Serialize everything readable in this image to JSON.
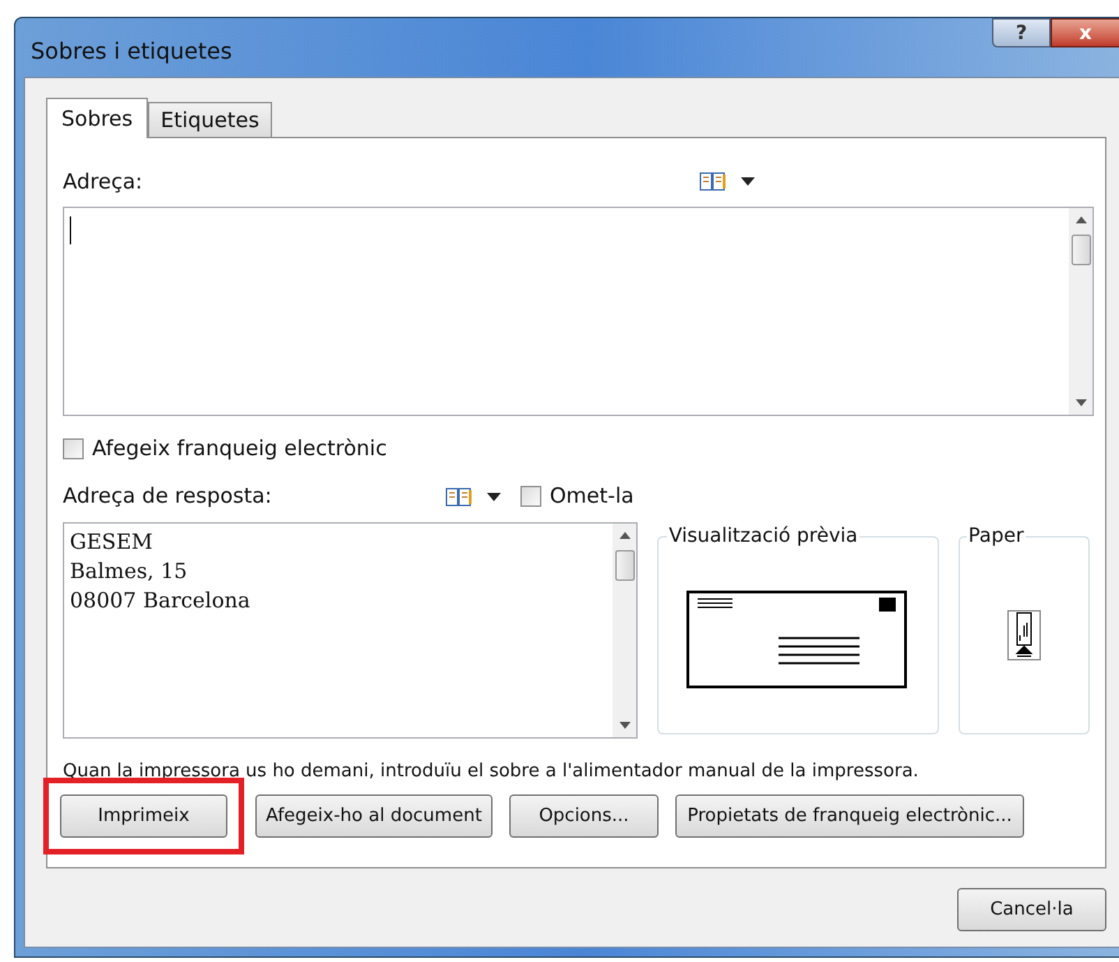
{
  "window": {
    "title": "Sobres i etiquetes",
    "help": "?",
    "close": "x"
  },
  "tabs": [
    {
      "label": "Sobres",
      "selected": true
    },
    {
      "label": "Etiquetes",
      "selected": false
    }
  ],
  "address": {
    "label": "Adreça:"
  },
  "electronic_postage": {
    "label": "Afegeix franqueig electrònic",
    "checked": false
  },
  "return_address": {
    "label": "Adreça de resposta:",
    "omit": {
      "label": "Omet-la",
      "checked": false
    },
    "lines": [
      "GESEM",
      "Balmes, 15",
      "08007 Barcelona"
    ]
  },
  "preview": {
    "title": "Visualització prèvia"
  },
  "paper": {
    "title": "Paper"
  },
  "note": "Quan la impressora us ho demani, introduïu el sobre a l'alimentador manual de la impressora.",
  "buttons": [
    {
      "label": "Imprimeix",
      "highlighted": true
    },
    {
      "label": "Afegeix-ho al document",
      "highlighted": false
    },
    {
      "label": "Opcions...",
      "highlighted": false
    },
    {
      "label": "Propietats de franqueig electrònic...",
      "highlighted": false
    }
  ],
  "cancel": "Cancel·la"
}
